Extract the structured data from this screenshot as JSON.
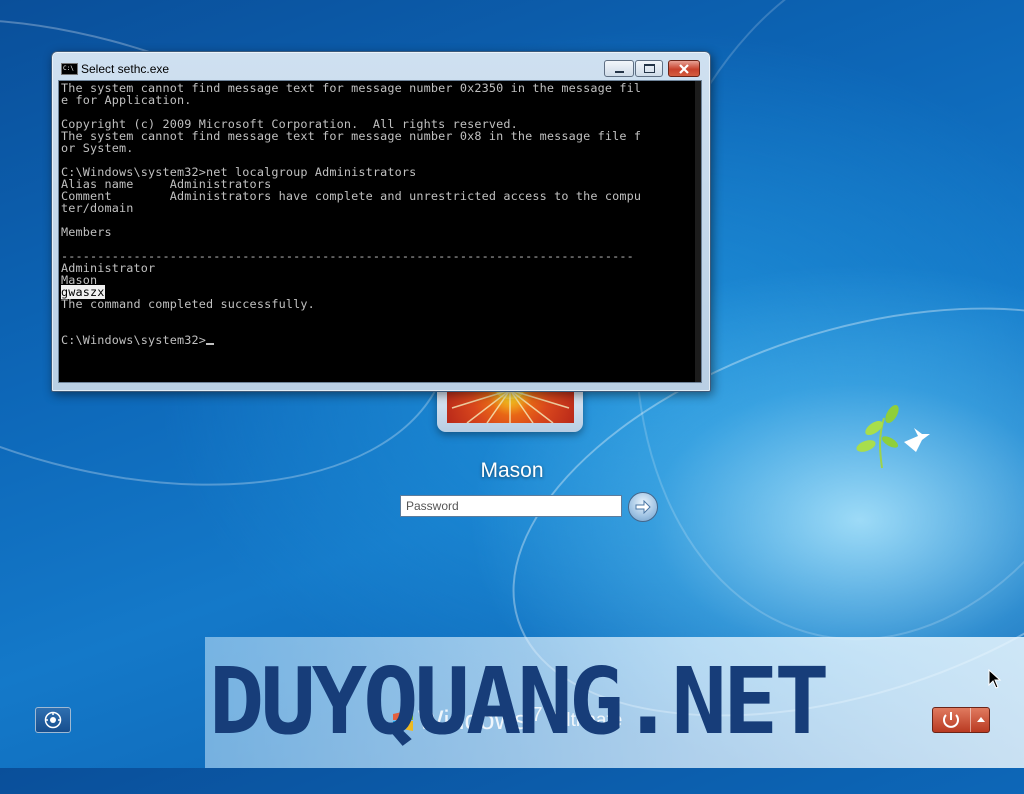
{
  "console_window": {
    "title": "Select sethc.exe",
    "lines": [
      "The system cannot find message text for message number 0x2350 in the message fil",
      "e for Application.",
      "",
      "Copyright (c) 2009 Microsoft Corporation.  All rights reserved.",
      "The system cannot find message text for message number 0x8 in the message file f",
      "or System.",
      "",
      "C:\\Windows\\system32>net localgroup Administrators",
      "Alias name     Administrators",
      "Comment        Administrators have complete and unrestricted access to the compu",
      "ter/domain",
      "",
      "Members",
      "",
      "-------------------------------------------------------------------------------",
      "Administrator",
      "Mason",
      "gwaszx",
      "The command completed successfully.",
      "",
      "",
      "C:\\Windows\\system32>"
    ],
    "highlighted_line": "gwaszx",
    "icon_label": "C:\\"
  },
  "logon": {
    "user_name": "Mason",
    "password_placeholder": "Password",
    "password_value": ""
  },
  "branding": {
    "windows_word": "Windows",
    "version": "7",
    "edition": "Ultimate"
  },
  "watermark": "DUYQUANG.NET",
  "icons": {
    "ease_of_access": "ease-of-access-icon",
    "submit_arrow": "arrow-right-icon",
    "shutdown": "power-icon",
    "shutdown_options": "triangle-up-icon"
  }
}
